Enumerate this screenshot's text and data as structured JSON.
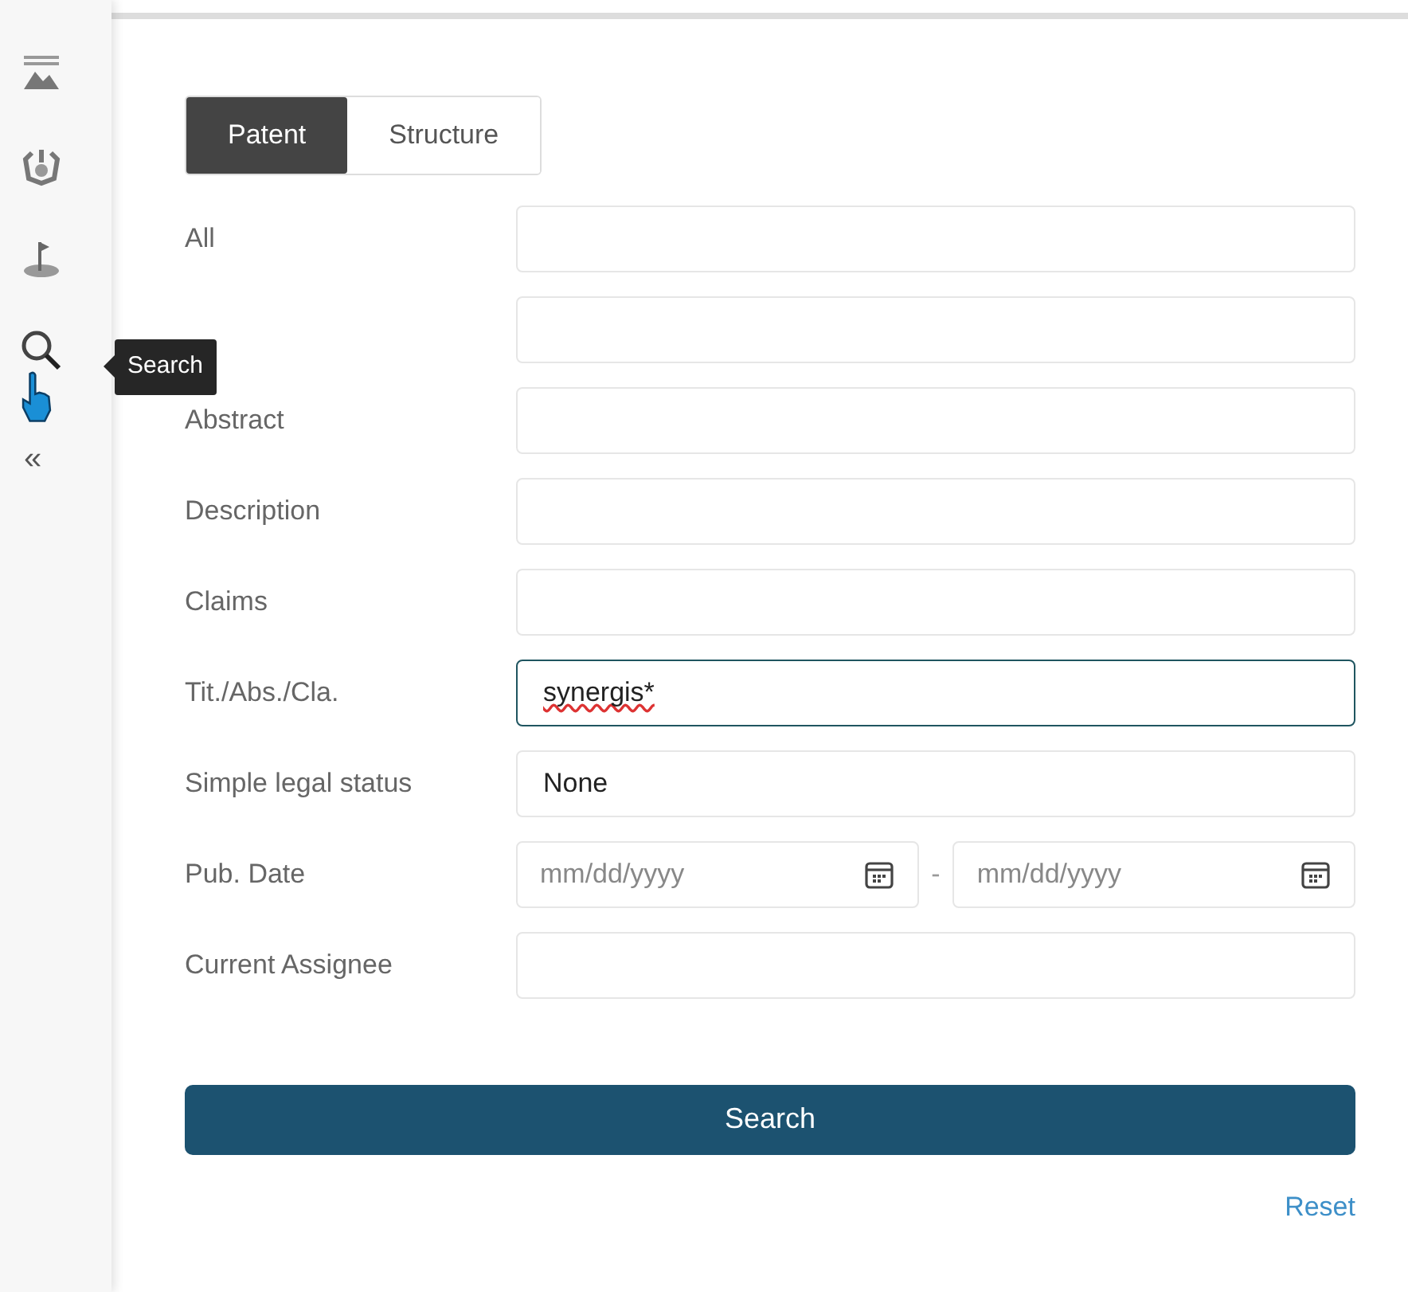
{
  "sidebar": {
    "items": [
      {
        "kind": "image"
      },
      {
        "kind": "cycle"
      },
      {
        "kind": "flag"
      },
      {
        "kind": "search",
        "tooltip": "Search"
      }
    ],
    "collapse": "«"
  },
  "tabs": [
    {
      "label": "Patent",
      "selected": true
    },
    {
      "label": "Structure",
      "selected": false
    }
  ],
  "fields": [
    {
      "label": "All",
      "kind": "text",
      "focused": false
    },
    {
      "kind": "text",
      "focused": false
    },
    {
      "label": "Abstract",
      "kind": "text",
      "focused": false
    },
    {
      "label": "Description",
      "kind": "text",
      "focused": false
    },
    {
      "label": "Claims",
      "kind": "text",
      "focused": false
    },
    {
      "label": "Tit./Abs./Cla.",
      "kind": "text",
      "value": "synergis*",
      "focused": true
    },
    {
      "label": "Simple legal status",
      "kind": "select",
      "value": "None",
      "focused": false
    },
    {
      "label": "Pub. Date",
      "kind": "daterange",
      "from_placeholder": "mm/dd/yyyy",
      "separator": "-",
      "to_placeholder": "mm/dd/yyyy"
    },
    {
      "label": "Current Assignee",
      "kind": "text",
      "focused": false
    }
  ],
  "search_button": "Search",
  "reset_link": "Reset"
}
